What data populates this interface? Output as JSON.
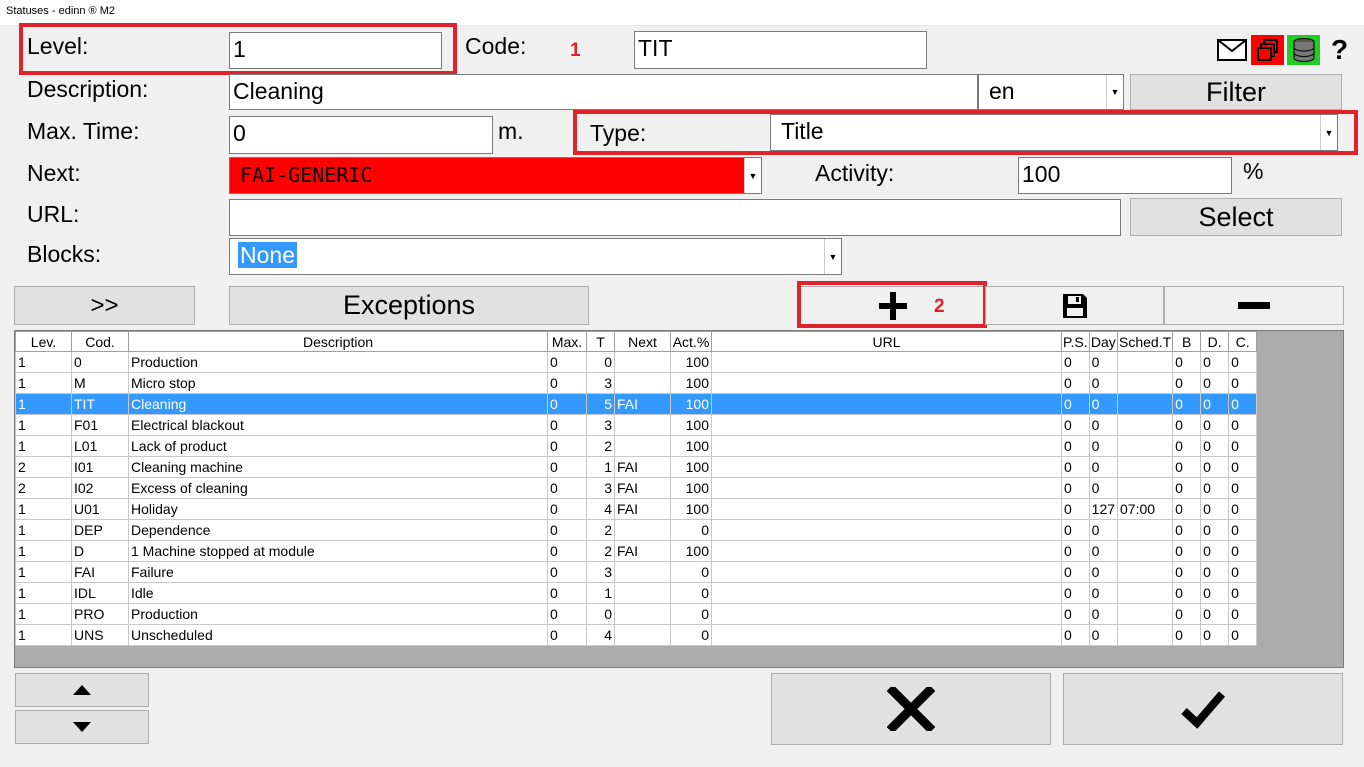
{
  "window": {
    "title": "Statuses - edinn ® M2"
  },
  "form": {
    "level_label": "Level:",
    "level_value": "1",
    "code_label": "Code:",
    "code_value": "TIT",
    "description_label": "Description:",
    "description_value": "Cleaning",
    "language_value": "en",
    "filter_label": "Filter",
    "max_time_label": "Max. Time:",
    "max_time_value": "0",
    "max_time_unit": "m.",
    "type_label": "Type:",
    "type_value": "Title",
    "next_label": "Next:",
    "next_value": "FAI-GENERIC",
    "activity_label": "Activity:",
    "activity_value": "100",
    "activity_unit": "%",
    "url_label": "URL:",
    "url_value": "",
    "select_label": "Select",
    "blocks_label": "Blocks:",
    "blocks_value": "None"
  },
  "annotations": {
    "one": "1",
    "two": "2"
  },
  "toolbar": {
    "expand_label": ">>",
    "exceptions_label": "Exceptions"
  },
  "table": {
    "headers": [
      "Lev.",
      "Cod.",
      "Description",
      "Max.",
      "T",
      "Next",
      "Act.%",
      "URL",
      "P.S.",
      "Day",
      "Sched.T",
      "B",
      "D.",
      "C."
    ],
    "rows": [
      [
        "1",
        "0",
        "Production",
        "0",
        "0",
        "",
        "100",
        "",
        "0",
        "0",
        "",
        "0",
        "0",
        "0"
      ],
      [
        "1",
        "M",
        "Micro stop",
        "0",
        "3",
        "",
        "100",
        "",
        "0",
        "0",
        "",
        "0",
        "0",
        "0"
      ],
      [
        "1",
        "TIT",
        "Cleaning",
        "0",
        "5",
        "FAI",
        "100",
        "",
        "0",
        "0",
        "",
        "0",
        "0",
        "0"
      ],
      [
        "1",
        "F01",
        "Electrical blackout",
        "0",
        "3",
        "",
        "100",
        "",
        "0",
        "0",
        "",
        "0",
        "0",
        "0"
      ],
      [
        "1",
        "L01",
        "Lack of product",
        "0",
        "2",
        "",
        "100",
        "",
        "0",
        "0",
        "",
        "0",
        "0",
        "0"
      ],
      [
        "2",
        "I01",
        "Cleaning machine",
        "0",
        "1",
        "FAI",
        "100",
        "",
        "0",
        "0",
        "",
        "0",
        "0",
        "0"
      ],
      [
        "2",
        "I02",
        "Excess of cleaning",
        "0",
        "3",
        "FAI",
        "100",
        "",
        "0",
        "0",
        "",
        "0",
        "0",
        "0"
      ],
      [
        "1",
        "U01",
        "Holiday",
        "0",
        "4",
        "FAI",
        "100",
        "",
        "0",
        "127",
        "07:00",
        "0",
        "0",
        "0"
      ],
      [
        "1",
        "DEP",
        "Dependence",
        "0",
        "2",
        "",
        "0",
        "",
        "0",
        "0",
        "",
        "0",
        "0",
        "0"
      ],
      [
        "1",
        "D",
        "1 Machine stopped at module",
        "0",
        "2",
        "FAI",
        "100",
        "",
        "0",
        "0",
        "",
        "0",
        "0",
        "0"
      ],
      [
        "1",
        "FAI",
        "Failure",
        "0",
        "3",
        "",
        "0",
        "",
        "0",
        "0",
        "",
        "0",
        "0",
        "0"
      ],
      [
        "1",
        "IDL",
        "Idle",
        "0",
        "1",
        "",
        "0",
        "",
        "0",
        "0",
        "",
        "0",
        "0",
        "0"
      ],
      [
        "1",
        "PRO",
        "Production",
        "0",
        "0",
        "",
        "0",
        "",
        "0",
        "0",
        "",
        "0",
        "0",
        "0"
      ],
      [
        "1",
        "UNS",
        "Unscheduled",
        "0",
        "4",
        "",
        "0",
        "",
        "0",
        "0",
        "",
        "0",
        "0",
        "0"
      ]
    ],
    "selected_row": 2
  },
  "colors": {
    "selection": "#3399ff",
    "annotation": "#e0222b",
    "next_bg": "#ff0000",
    "db_icon_bg": "#22cc22"
  },
  "icons": [
    "mail-icon",
    "windows-icon",
    "database-icon",
    "help-icon",
    "plus-icon",
    "save-icon",
    "minus-icon",
    "up-arrow-icon",
    "down-arrow-icon",
    "cancel-icon",
    "accept-icon"
  ]
}
